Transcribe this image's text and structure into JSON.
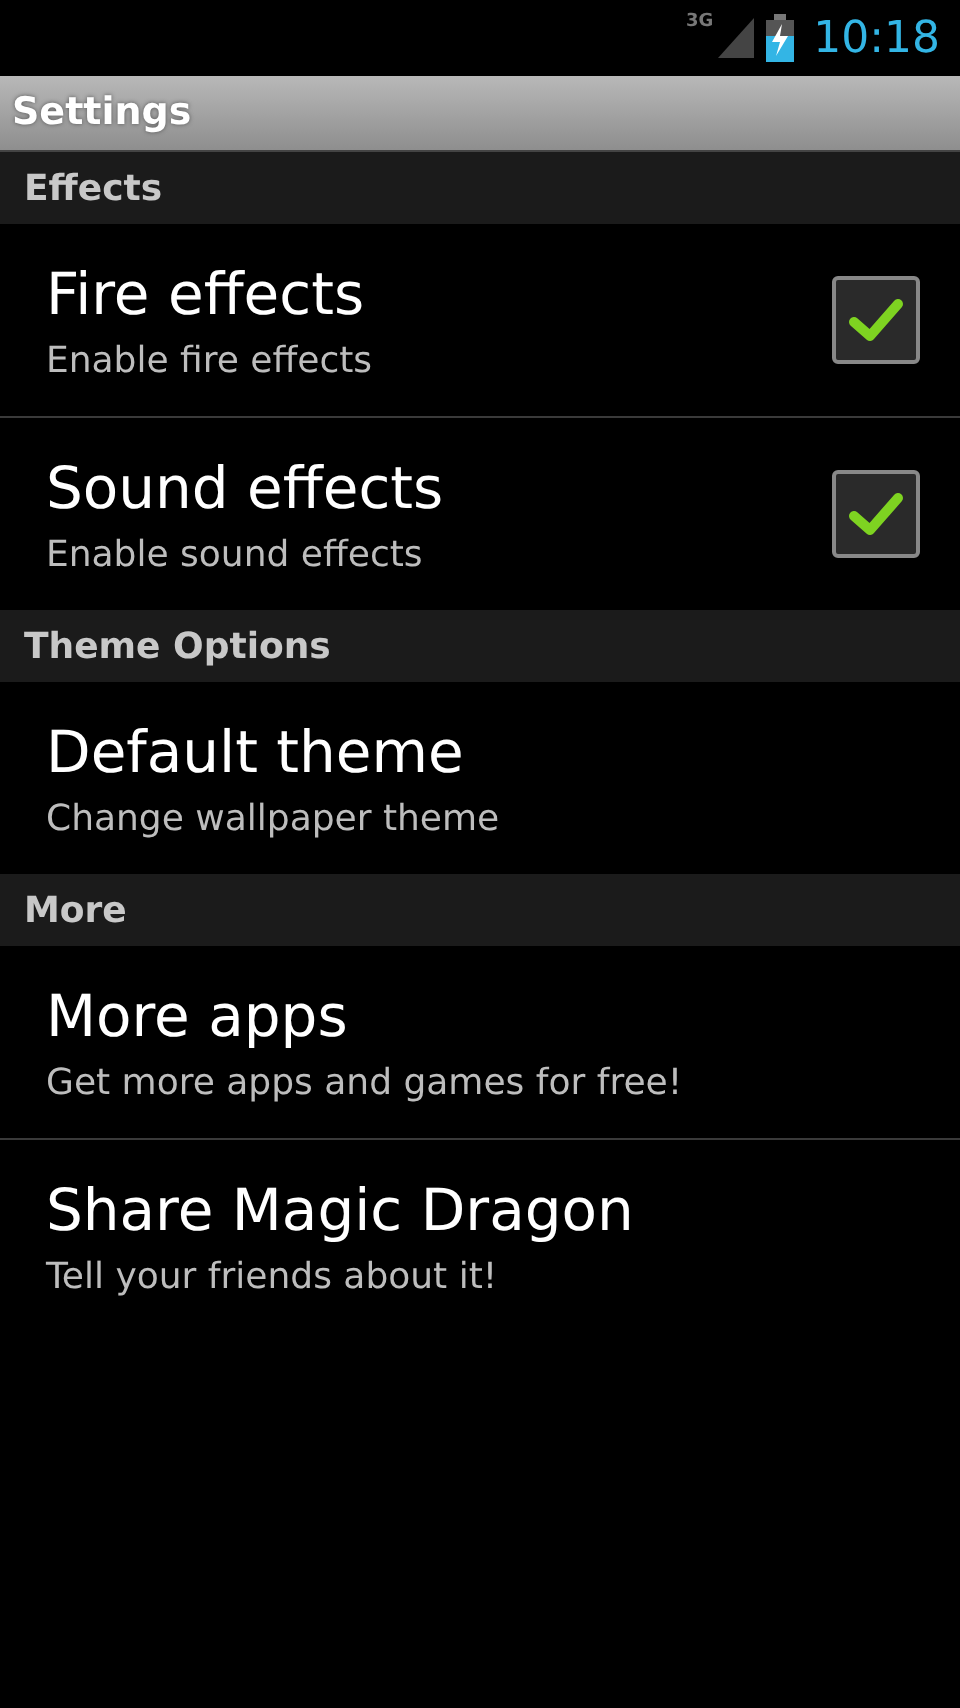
{
  "status_bar": {
    "network": "3G",
    "time": "10:18"
  },
  "title": "Settings",
  "sections": [
    {
      "header": "Effects",
      "items": [
        {
          "kind": "checkbox",
          "title": "Fire effects",
          "summary": "Enable fire effects",
          "checked": true
        },
        {
          "kind": "checkbox",
          "title": "Sound effects",
          "summary": "Enable sound effects",
          "checked": true
        }
      ]
    },
    {
      "header": "Theme Options",
      "items": [
        {
          "kind": "plain",
          "title": "Default theme",
          "summary": "Change wallpaper theme"
        }
      ]
    },
    {
      "header": "More",
      "items": [
        {
          "kind": "plain",
          "title": "More apps",
          "summary": "Get more apps and games for free!"
        },
        {
          "kind": "plain",
          "title": "Share Magic Dragon",
          "summary": "Tell your friends about it!"
        }
      ]
    }
  ]
}
